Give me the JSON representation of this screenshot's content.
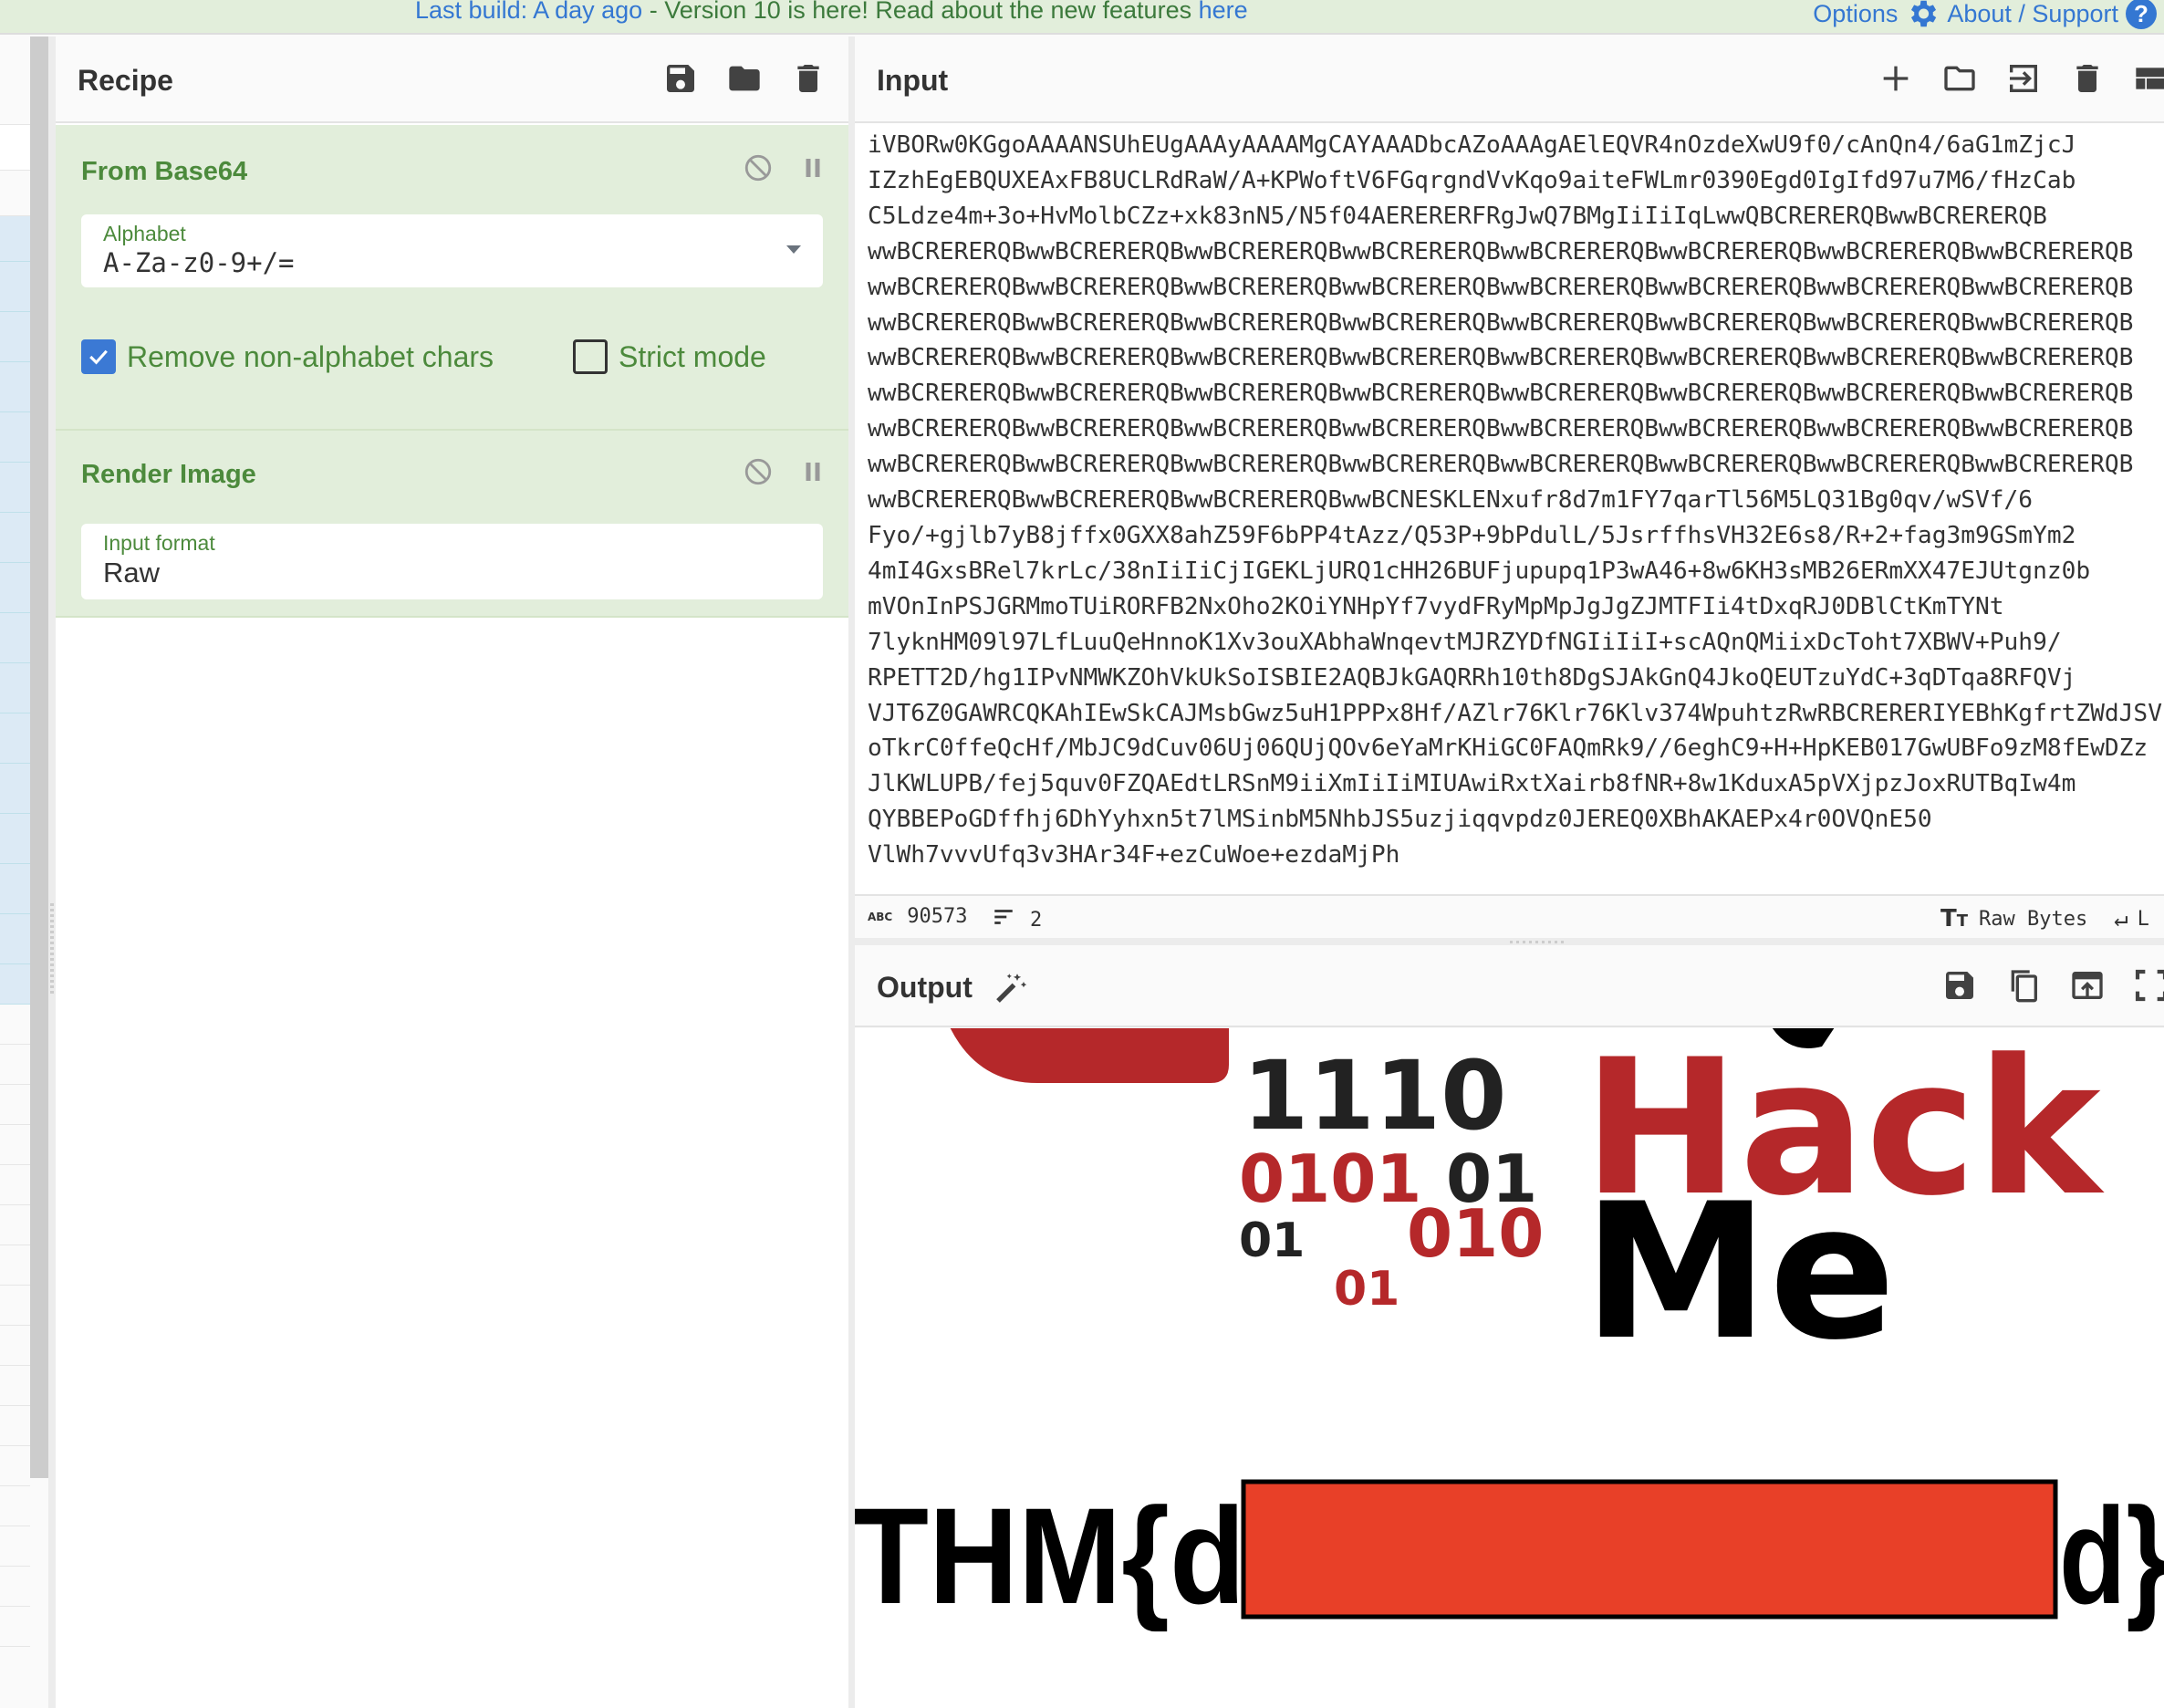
{
  "banner": {
    "last_build_label": "Last build: A day ago",
    "separator": " - ",
    "version_text": "Version 10 is here! Read about the new features ",
    "here_link": "here",
    "options_label": "Options",
    "about_label": "About / Support",
    "help_glyph": "?",
    "accent_color": "#3477d2"
  },
  "recipe": {
    "title": "Recipe",
    "header_icons": [
      "save-icon",
      "folder-icon",
      "trash-icon"
    ],
    "operations": [
      {
        "name": "From Base64",
        "alphabet_label": "Alphabet",
        "alphabet_value": "A-Za-z0-9+/=",
        "remove_non_alphabet_label": "Remove non-alphabet chars",
        "remove_non_alphabet_checked": true,
        "strict_mode_label": "Strict mode",
        "strict_mode_checked": false
      },
      {
        "name": "Render Image",
        "input_format_label": "Input format",
        "input_format_value": "Raw"
      }
    ]
  },
  "input": {
    "title": "Input",
    "header_icons": [
      "plus-icon",
      "folder-icon",
      "import-icon",
      "trash-icon",
      "layout-icon"
    ],
    "lines": [
      "iVBORw0KGgoAAAANSUhEUgAAAyAAAAMgCAYAAADbcAZoAAAgAElEQVR4nOzdeXwU9f0/cAnQn4/6aG1mZjcJ",
      "IZzhEgEBQUXEAxFB8UCLRdRaW/A+KPWoftV6FGqrgndVvKqo9aiteFWLmr0390Egd0IgIfd97u7M6/fHzCab",
      "C5Ldze4m+3o+HvMolbCZz+xk83nN5/N5f04AERERERFRgJwQ7BMgIiIiIqLwwQBCRERERQBwwBCRERERQB",
      "wwBCRERERQBwwBCRERERQBwwBCRERERQBwwBCRERERQBwwBCRERERQBwwBCRERERQBwwBCRERERQBwwBCRERERQB",
      "wwBCRERERQBwwBCRERERQBwwBCRERERQBwwBCRERERQBwwBCRERERQBwwBCRERERQBwwBCRERERQBwwBCRERERQB",
      "wwBCRERERQBwwBCRERERQBwwBCRERERQBwwBCRERERQBwwBCRERERQBwwBCRERERQBwwBCRERERQBwwBCRERERQB",
      "wwBCRERERQBwwBCRERERQBwwBCRERERQBwwBCRERERQBwwBCRERERQBwwBCRERERQBwwBCRERERQBwwBCRERERQB",
      "wwBCRERERQBwwBCRERERQBwwBCRERERQBwwBCRERERQBwwBCRERERQBwwBCRERERQBwwBCRERERQBwwBCRERERQB",
      "wwBCRERERQBwwBCRERERQBwwBCRERERQBwwBCRERERQBwwBCRERERQBwwBCRERERQBwwBCRERERQBwwBCRERERQB",
      "wwBCRERERQBwwBCRERERQBwwBCRERERQBwwBCRERERQBwwBCRERERQBwwBCRERERQBwwBCRERERQBwwBCRERERQB",
      "wwBCRERERQBwwBCRERERQBwwBCRERERQBwwBCNESKLENxufr8d7m1FY7qarTl56M5LQ31Bg0qv/wSVf/6",
      "Fyo/+gjlb7yB8jffx0GXX8ahZ59F6bPP4tAzz/Q53P+9bPdulL/5JsrffhsVH32E6s8/R+2+fag3m9GSmYm2",
      "4mI4GxsBRel7krLc/38nIiIiCjIGEKLjURQ1cHH26BUFjupupq1P3wA46+8w6KH3sMB26ERmXX47EJUtgnz0b",
      "mVOnInPSJGRMmoTUiRORFB2NxOho2KOiYNHpYf7vydFRyMpMpJgJgZJMTFIi4tDxqRJ0DBlCtKmTYNt",
      "7lyknHM09l97LfLuuQeHnnoK1Xv3ouXAbhaWnqevtMJRZYDfNGIiIiI+scAQnQMiixDcToht7XBWV+Puh9/",
      "RPETT2D/hg1IPvNMWKZOhVkUkSoISBIE2AQBJkGAQRRh10th8DgSJAkGnQ4JkoQEUTzuYdC+3qDTqa8RFQVj",
      "VJT6Z0GAWRCQKAhIEwSkCAJMsbGwz5uH1PPPx8Hf/AZlr76Klr76Klv374WpuhtzRwRBCRERERIYEBhKgfrtZWdJSV",
      "oTkrC0ffeQcHf/MbJC9dCuv06Uj06QUjQOv6eYaMrKHiGC0FAQmRk9//6eghC9+H+HpKEB017GwUBFo9zM8fEwDZz",
      "JlKWLUPB/fej5quv0FZQAEdtLRSnM9iiXmIiIiMIUAwiRxtXairb8fNR+8w1KduxA5pVXjpzJoxRUTBqIw4m",
      "QYBBEPoGDffhj6DhYyhxn5t7lMSinbM5NhbJS5uzjiqqvpdz0JEREQ0XBhAKAEPx4r0OVQnE50",
      "VlWh7vvvUfq3v3HAr34F+ezCuWoe+ezdaMjPh"
    ],
    "status": {
      "char_count": "90573",
      "line_count": "2",
      "encoding_label": "Raw Bytes",
      "eol_label": "L"
    }
  },
  "output": {
    "title": "Output",
    "header_icons": [
      "save-icon",
      "copy-icon",
      "replace-input-icon",
      "maximize-icon"
    ],
    "image": {
      "binary_digits": [
        {
          "text": "1110",
          "color": "#222222"
        },
        {
          "text": "0101",
          "color": "#b5282a"
        },
        {
          "text": "01",
          "color": "#222222"
        },
        {
          "text": "01",
          "color": "#222222"
        },
        {
          "text": "010",
          "color": "#b5282a"
        },
        {
          "text": "01",
          "color": "#b5282a"
        }
      ],
      "word_hack": "Hack",
      "word_me": "Me",
      "flag_prefix": "THM{d",
      "flag_suffix": "d}",
      "redaction_color": "#e84028",
      "brand_red": "#b5282a"
    }
  }
}
